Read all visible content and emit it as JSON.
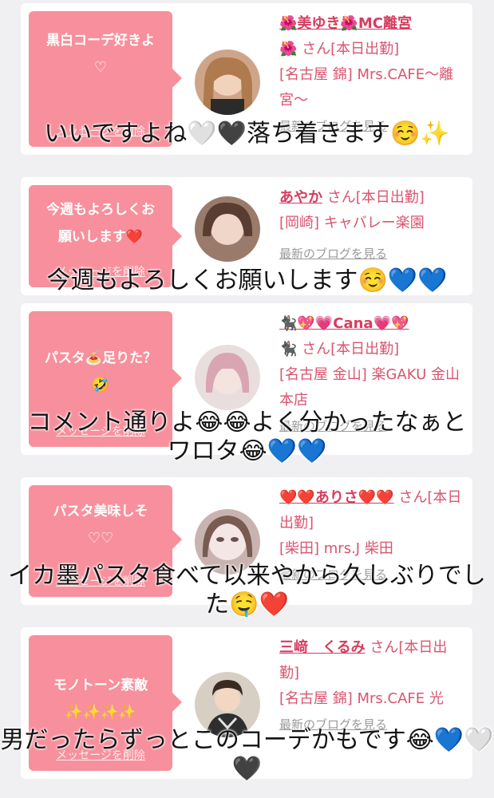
{
  "cards": [
    {
      "message": "黒白コーデ好きよ",
      "message_sub": "♡",
      "delete_label": "メッセージを削除",
      "name": "🌺美ゆき🌺MC離宮",
      "name_line2": "🌺",
      "suffix": "さん[本日出勤]",
      "shop": "[名古屋 錦] Mrs.CAFE〜離宮〜",
      "blog": "最新のブログを見る",
      "caption": "いいですよね🤍🖤落ち着きます☺️✨"
    },
    {
      "message": "今週もよろしくお願いします❤️",
      "message_sub": "",
      "delete_label": "メッセージを削除",
      "name": "あやか",
      "name_line2": "",
      "suffix": "さん[本日出勤]",
      "shop": "[岡崎] キャバレー楽園",
      "blog": "最新のブログを見る",
      "caption": "今週もよろしくお願いします☺️💙💙"
    },
    {
      "message": "パスタ🍝足りた？",
      "message_sub": "🤣",
      "delete_label": "メッセージを削除",
      "name": "🐈‍⬛💖💗Cana💗💖",
      "name_line2": "🐈‍⬛",
      "suffix": "さん[本日出勤]",
      "shop": "[名古屋 金山] 楽GAKU 金山本店",
      "blog": "最新のブログを見る",
      "caption": "コメント通りよ😂😂よく分かったなぁとワロタ😂💙💙"
    },
    {
      "message": "パスタ美味しそ",
      "message_sub": "♡♡",
      "delete_label": "メッセージを削除",
      "name": "❤️❤️ありさ❤️❤️",
      "name_line2": "",
      "suffix": "さん[本日出勤]",
      "shop": "[柴田] mrs.J 柴田",
      "blog": "最新のブログを見る",
      "caption": "イカ墨パスタ食べて以来やから久しぶりでした🤤❤️"
    },
    {
      "message": "モノトーン素敵",
      "message_sub": "✨✨✨✨",
      "delete_label": "メッセージを削除",
      "name": "三﨑　くるみ",
      "name_line2": "",
      "suffix": "さん[本日出勤]",
      "shop": "[名古屋 錦] Mrs.CAFE 光",
      "blog": "最新のブログを見る",
      "caption": "男だったらずっとこのコーデかもです😂💙🤍🖤"
    }
  ],
  "colors": {
    "bubble": "#f7909c",
    "name": "#d63d5f",
    "text": "#d9556f",
    "link_gray": "#9a9a9a",
    "background": "#f0f0f2"
  }
}
